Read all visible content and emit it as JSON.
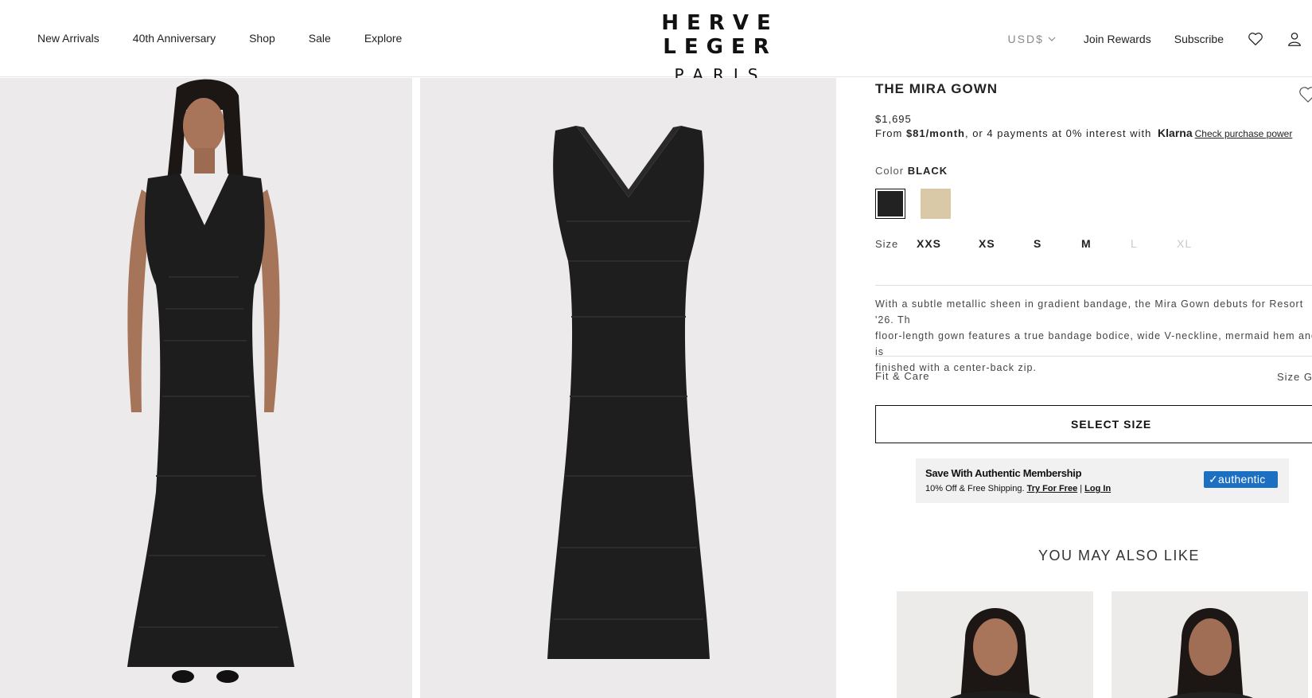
{
  "nav": {
    "items": [
      "New Arrivals",
      "40th Anniversary",
      "Shop",
      "Sale",
      "Explore"
    ]
  },
  "brand": {
    "line1": "HERVE LEGER",
    "line2": "PARIS"
  },
  "header_right": {
    "currency": "USD$",
    "join_rewards": "Join Rewards",
    "subscribe": "Subscribe",
    "icons": [
      "heart-icon",
      "user-icon"
    ]
  },
  "product": {
    "title": "THE MIRA GOWN",
    "price": "$1,695",
    "klarna": {
      "prefix": "From ",
      "monthly": "$81/month",
      "suffix": ", or 4 payments at 0% interest with",
      "brand": "Klarna",
      "link": "Check purchase power"
    },
    "color_label": "Color",
    "color_value": "BLACK",
    "swatches": [
      {
        "name": "black",
        "hex": "#222222",
        "selected": true
      },
      {
        "name": "gold",
        "hex": "#d9c9a6",
        "selected": false
      }
    ],
    "size_label": "Size",
    "sizes": [
      {
        "label": "XXS",
        "available": true
      },
      {
        "label": "XS",
        "available": true
      },
      {
        "label": "S",
        "available": true
      },
      {
        "label": "M",
        "available": true
      },
      {
        "label": "L",
        "available": false
      },
      {
        "label": "XL",
        "available": false
      }
    ],
    "description_lines": [
      "With a subtle metallic sheen in gradient bandage, the Mira Gown debuts for Resort '26. Th",
      "floor-length gown features a true bandage bodice, wide V-neckline, mermaid hem and is",
      "finished with a center-back zip."
    ],
    "fit_care": "Fit & Care",
    "size_guide": "Size Gu",
    "select_size": "SELECT SIZE"
  },
  "authentic": {
    "title": "Save With Authentic Membership",
    "subtitle": "10% Off & Free Shipping.",
    "try_link": "Try For Free",
    "separator": "|",
    "login_link": "Log In",
    "logo_text": "authentic"
  },
  "recommendations": {
    "heading": "YOU MAY ALSO LIKE"
  },
  "colors": {
    "accent": "#111111",
    "image_bg": "#eceaeb",
    "authentic_blue": "#1d6fc2"
  }
}
